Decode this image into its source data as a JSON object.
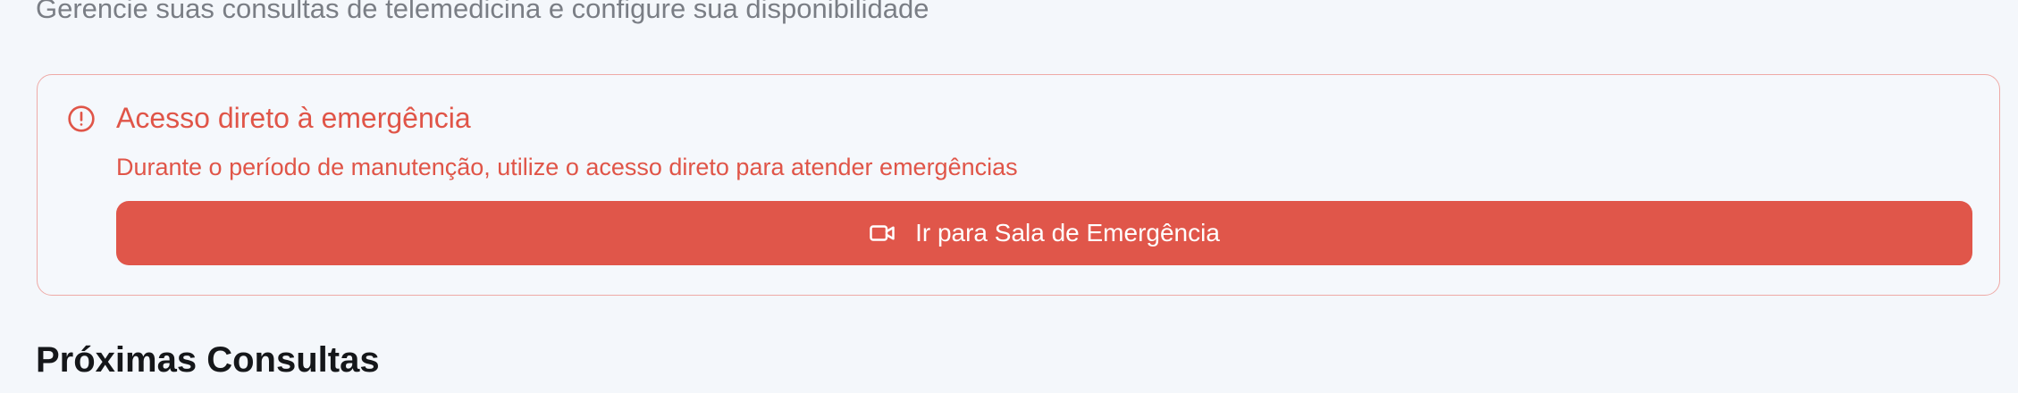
{
  "header": {
    "subtitle": "Gerencie suas consultas de telemedicina e configure sua disponibilidade"
  },
  "alert": {
    "icon": "alert-circle-icon",
    "title": "Acesso direto à emergência",
    "description": "Durante o período de manutenção, utilize o acesso direto para atender emergências",
    "button_label": "Ir para Sala de Emergência",
    "button_icon": "video-icon",
    "colors": {
      "accent": "#e0564a",
      "border": "#eeaaa6",
      "text": "#e05548"
    }
  },
  "sections": {
    "upcoming_title": "Próximas Consultas"
  }
}
